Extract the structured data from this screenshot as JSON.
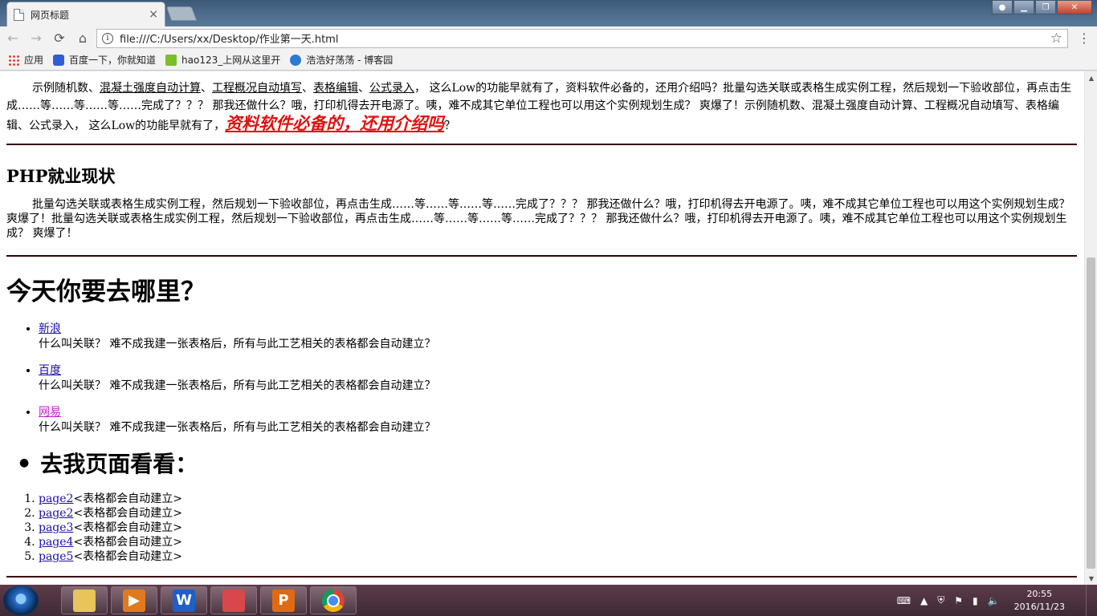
{
  "browser": {
    "tab_title": "网页标题",
    "tab_close": "×",
    "url": "file:///C:/Users/xx/Desktop/作业第一天.html",
    "bookmarks": [
      {
        "label": "应用",
        "icon": "apps-icon"
      },
      {
        "label": "百度一下，你就知道",
        "icon": "baidu-icon"
      },
      {
        "label": "hao123_上网从这里开",
        "icon": "hao123-icon"
      },
      {
        "label": "浩浩好荡荡 - 博客园",
        "icon": "cnblogs-icon"
      }
    ]
  },
  "page": {
    "p1": {
      "prefix": "示例随机数、",
      "link1": "混凝土强度自动计算",
      "sep1": "、",
      "link2": "工程概况自动填写",
      "sep2": "、",
      "link3": "表格编辑",
      "sep3": "、",
      "link4": "公式录入",
      "mid": "， 这么Low的功能早就有了，资料软件必备的，还用介绍吗？批量勾选关联或表格生成实例工程，然后规划一下验收部位，再点击生成……等……等……等……完成了？？？ 那我还做什么？哦，打印机得去开电源了。咦，难不成其它单位工程也可以用这个实例规划生成？ 爽爆了！示例随机数、混凝土强度自动计算、工程概况自动填写、表格编辑、公式录入， 这么Low的功能早就有了，",
      "big_link": "资料软件必备的，还用介绍吗",
      "suffix": "？"
    },
    "heading_php": "PHP就业现状",
    "p2": "批量勾选关联或表格生成实例工程，然后规划一下验收部位，再点击生成……等……等……等……完成了？？？ 那我还做什么？哦，打印机得去开电源了。咦，难不成其它单位工程也可以用这个实例规划生成？ 爽爆了！批量勾选关联或表格生成实例工程，然后规划一下验收部位，再点击生成……等……等……等……完成了？？？ 那我还做什么？哦，打印机得去开电源了。咦，难不成其它单位工程也可以用这个实例规划生成？ 爽爆了！",
    "heading_where": "今天你要去哪里？",
    "sites": [
      {
        "name": "新浪",
        "desc": "什么叫关联？ 难不成我建一张表格后，所有与此工艺相关的表格都会自动建立？"
      },
      {
        "name": "百度",
        "desc": "什么叫关联？ 难不成我建一张表格后，所有与此工艺相关的表格都会自动建立？"
      },
      {
        "name": "网易",
        "desc": "什么叫关联？ 难不成我建一张表格后，所有与此工艺相关的表格都会自动建立？"
      }
    ],
    "heading_visit": "去我页面看看：",
    "pages": [
      {
        "link": "page2",
        "text": "<表格都会自动建立>"
      },
      {
        "link": "page2",
        "text": "<表格都会自动建立>"
      },
      {
        "link": "page3",
        "text": "<表格都会自动建立>"
      },
      {
        "link": "page4",
        "text": "<表格都会自动建立>"
      },
      {
        "link": "page5",
        "text": "<表格都会自动建立>"
      }
    ]
  },
  "taskbar": {
    "time": "20:55",
    "date": "2016/11/23"
  },
  "colors": {
    "link": "#1a0dab",
    "visited_link": "#c41bd3",
    "highlight_link": "#e01111",
    "rule": "#3a0000"
  }
}
